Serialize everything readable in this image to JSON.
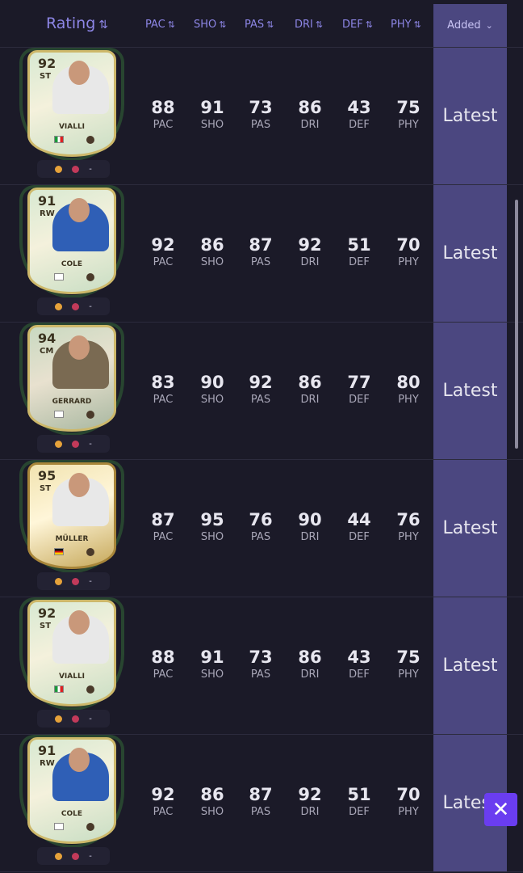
{
  "header": {
    "rating_label": "Rating",
    "sort_icon": "⇅",
    "columns": [
      "PAC",
      "SHO",
      "PAS",
      "DRI",
      "DEF",
      "PHY"
    ],
    "added_label": "Added",
    "added_chevron": "⌄"
  },
  "rows": [
    {
      "card": {
        "rating": "92",
        "position": "ST",
        "name": "VIALLI",
        "flag": "it",
        "style": "green",
        "photo": "white"
      },
      "chem": [
        "-"
      ],
      "stats": [
        {
          "value": "88",
          "label": "PAC"
        },
        {
          "value": "91",
          "label": "SHO"
        },
        {
          "value": "73",
          "label": "PAS"
        },
        {
          "value": "86",
          "label": "DRI"
        },
        {
          "value": "43",
          "label": "DEF"
        },
        {
          "value": "75",
          "label": "PHY"
        }
      ],
      "added": "Latest"
    },
    {
      "card": {
        "rating": "91",
        "position": "RW",
        "name": "COLE",
        "flag": "en",
        "style": "green",
        "photo": "blue"
      },
      "chem": [
        "-"
      ],
      "stats": [
        {
          "value": "92",
          "label": "PAC"
        },
        {
          "value": "86",
          "label": "SHO"
        },
        {
          "value": "87",
          "label": "PAS"
        },
        {
          "value": "92",
          "label": "DRI"
        },
        {
          "value": "51",
          "label": "DEF"
        },
        {
          "value": "70",
          "label": "PHY"
        }
      ],
      "added": "Latest"
    },
    {
      "card": {
        "rating": "94",
        "position": "CM",
        "name": "GERRARD",
        "flag": "en",
        "style": "brown",
        "photo": "brown"
      },
      "chem": [
        "-"
      ],
      "stats": [
        {
          "value": "83",
          "label": "PAC"
        },
        {
          "value": "90",
          "label": "SHO"
        },
        {
          "value": "92",
          "label": "PAS"
        },
        {
          "value": "86",
          "label": "DRI"
        },
        {
          "value": "77",
          "label": "DEF"
        },
        {
          "value": "80",
          "label": "PHY"
        }
      ],
      "added": "Latest"
    },
    {
      "card": {
        "rating": "95",
        "position": "ST",
        "name": "MÜLLER",
        "flag": "de",
        "style": "gold",
        "photo": "white"
      },
      "chem": [
        "-"
      ],
      "stats": [
        {
          "value": "87",
          "label": "PAC"
        },
        {
          "value": "95",
          "label": "SHO"
        },
        {
          "value": "76",
          "label": "PAS"
        },
        {
          "value": "90",
          "label": "DRI"
        },
        {
          "value": "44",
          "label": "DEF"
        },
        {
          "value": "76",
          "label": "PHY"
        }
      ],
      "added": "Latest"
    },
    {
      "card": {
        "rating": "92",
        "position": "ST",
        "name": "VIALLI",
        "flag": "it",
        "style": "green",
        "photo": "white"
      },
      "chem": [
        "-"
      ],
      "stats": [
        {
          "value": "88",
          "label": "PAC"
        },
        {
          "value": "91",
          "label": "SHO"
        },
        {
          "value": "73",
          "label": "PAS"
        },
        {
          "value": "86",
          "label": "DRI"
        },
        {
          "value": "43",
          "label": "DEF"
        },
        {
          "value": "75",
          "label": "PHY"
        }
      ],
      "added": "Latest"
    },
    {
      "card": {
        "rating": "91",
        "position": "RW",
        "name": "COLE",
        "flag": "en",
        "style": "green",
        "photo": "blue"
      },
      "chem": [
        "-"
      ],
      "stats": [
        {
          "value": "92",
          "label": "PAC"
        },
        {
          "value": "86",
          "label": "SHO"
        },
        {
          "value": "87",
          "label": "PAS"
        },
        {
          "value": "92",
          "label": "DRI"
        },
        {
          "value": "51",
          "label": "DEF"
        },
        {
          "value": "70",
          "label": "PHY"
        }
      ],
      "added": "Latest"
    }
  ],
  "close_label": "✕",
  "colors": {
    "accent": "#8d86e6",
    "added_bg": "#4b4780",
    "close_bg": "#6a3df0",
    "background": "#1b1a28"
  }
}
